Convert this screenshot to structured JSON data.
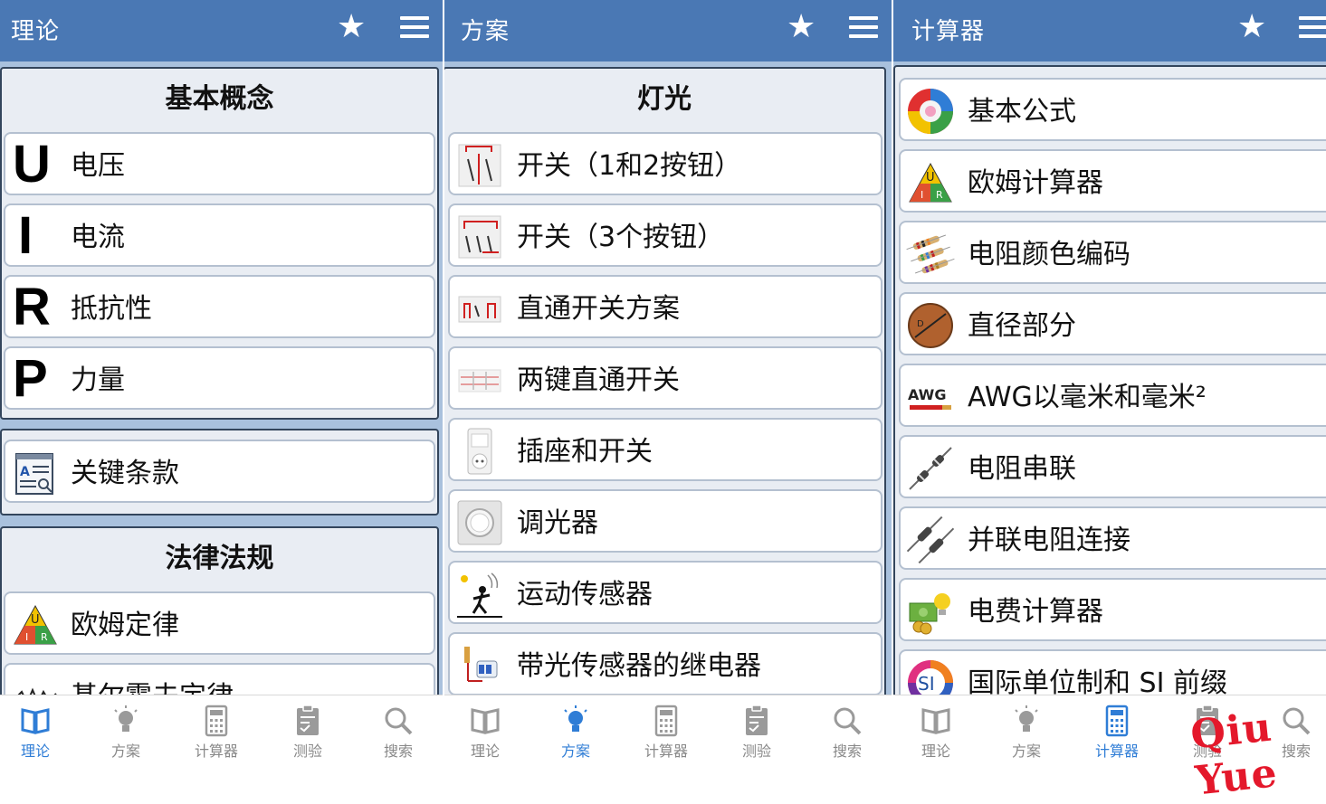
{
  "panels": [
    {
      "title": "理论",
      "sections": [
        {
          "header": "基本概念",
          "items": [
            {
              "label": "电压",
              "letter": "U"
            },
            {
              "label": "电流",
              "letter": "I"
            },
            {
              "label": "抵抗性",
              "letter": "R"
            },
            {
              "label": "力量",
              "letter": "P"
            }
          ]
        },
        {
          "items": [
            {
              "label": "关键条款",
              "icon": "glossary-icon"
            }
          ]
        },
        {
          "header": "法律法规",
          "items": [
            {
              "label": "欧姆定律",
              "icon": "ohm-triangle-icon"
            },
            {
              "label": "基尔霍夫定律",
              "icon": "kirchhoff-icon"
            }
          ]
        }
      ]
    },
    {
      "title": "方案",
      "sections": [
        {
          "header": "灯光",
          "items": [
            {
              "label": "开关（1和2按钮）",
              "icon": "switch-1-2-icon"
            },
            {
              "label": "开关（3个按钮）",
              "icon": "switch-3-icon"
            },
            {
              "label": "直通开关方案",
              "icon": "pass-switch-icon"
            },
            {
              "label": "两键直通开关",
              "icon": "two-key-pass-switch-icon"
            },
            {
              "label": "插座和开关",
              "icon": "socket-switch-icon"
            },
            {
              "label": "调光器",
              "icon": "dimmer-icon"
            },
            {
              "label": "运动传感器",
              "icon": "motion-sensor-icon"
            },
            {
              "label": "带光传感器的继电器",
              "icon": "light-sensor-relay-icon"
            }
          ]
        }
      ]
    },
    {
      "title": "计算器",
      "items": [
        {
          "label": "基本公式",
          "icon": "formula-wheel-icon"
        },
        {
          "label": "欧姆计算器",
          "icon": "ohm-triangle-icon"
        },
        {
          "label": "电阻颜色编码",
          "icon": "resistor-color-icon"
        },
        {
          "label": "直径部分",
          "icon": "diameter-icon"
        },
        {
          "label": "AWG以毫米和毫米²",
          "icon": "awg-icon",
          "icon_text": "AWG"
        },
        {
          "label": "电阻串联",
          "icon": "series-resistor-icon"
        },
        {
          "label": "并联电阻连接",
          "icon": "parallel-resistor-icon"
        },
        {
          "label": "电费计算器",
          "icon": "cost-calculator-icon"
        },
        {
          "label": "国际单位制和 SI 前缀",
          "icon": "si-icon",
          "icon_text": "SI"
        }
      ]
    }
  ],
  "nav": [
    "理论",
    "方案",
    "计算器",
    "测验",
    "搜索"
  ],
  "active_nav": [
    0,
    1,
    2
  ],
  "watermark": "Qiu Yue",
  "colors": {
    "appbar": "#4a78b4",
    "background": "#a9c1dd",
    "nav_active": "#2f7dd6",
    "nav_inactive": "#888888"
  }
}
